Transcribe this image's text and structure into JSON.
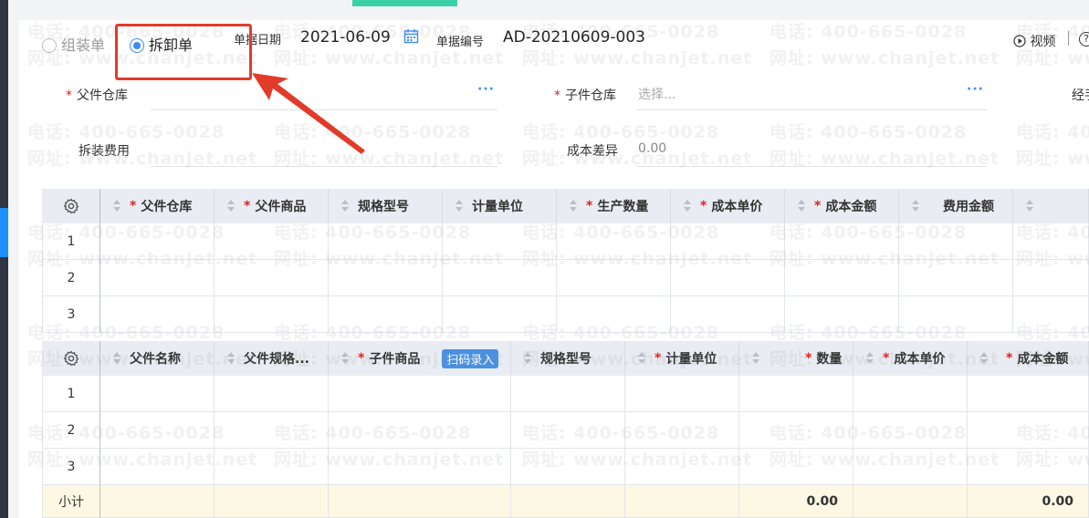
{
  "form": {
    "type_options": [
      {
        "label": "组装单",
        "selected": false
      },
      {
        "label": "拆卸单",
        "selected": true
      }
    ],
    "date_label": "单据日期",
    "date_value": "2021-06-09",
    "number_label": "单据编号",
    "number_value": "AD-20210609-003",
    "video_label": "视频",
    "help_text": "?",
    "parent_warehouse_label": "父件仓库",
    "child_warehouse_label": "子件仓库",
    "child_warehouse_placeholder": "选择...",
    "handler_label": "经手",
    "assembly_fee_label": "拆装费用",
    "cost_diff_label": "成本差异",
    "cost_diff_value": "0.00",
    "more_dots": "···"
  },
  "parent_table": {
    "columns": [
      "父件仓库",
      "父件商品",
      "规格型号",
      "计量单位",
      "生产数量",
      "成本单价",
      "成本金额",
      "费用金额",
      ""
    ],
    "required": [
      true,
      true,
      false,
      false,
      true,
      true,
      true,
      false,
      false
    ],
    "rows": [
      "1",
      "2",
      "3"
    ]
  },
  "child_table": {
    "columns": [
      "父件名称",
      "父件规格...",
      "子件商品",
      "规格型号",
      "计量单位",
      "数量",
      "成本单价",
      "成本金额"
    ],
    "required": [
      false,
      false,
      true,
      false,
      true,
      true,
      true,
      true
    ],
    "scan_button": "扫码录入",
    "rows": [
      "1",
      "2",
      "3"
    ],
    "subtotal_label": "小计",
    "subtotal_quantity": "0.00",
    "subtotal_amount": "0.00"
  },
  "watermark": {
    "phone": "电话: 400-665-0028",
    "site": "网址: www.chanjet.net"
  },
  "colors": {
    "accent": "#3b8cf5",
    "highlight": "#e23b2a",
    "required": "#e02020",
    "subtotal_bg": "#fdf8e4",
    "header_bg": "#e9edf3"
  }
}
